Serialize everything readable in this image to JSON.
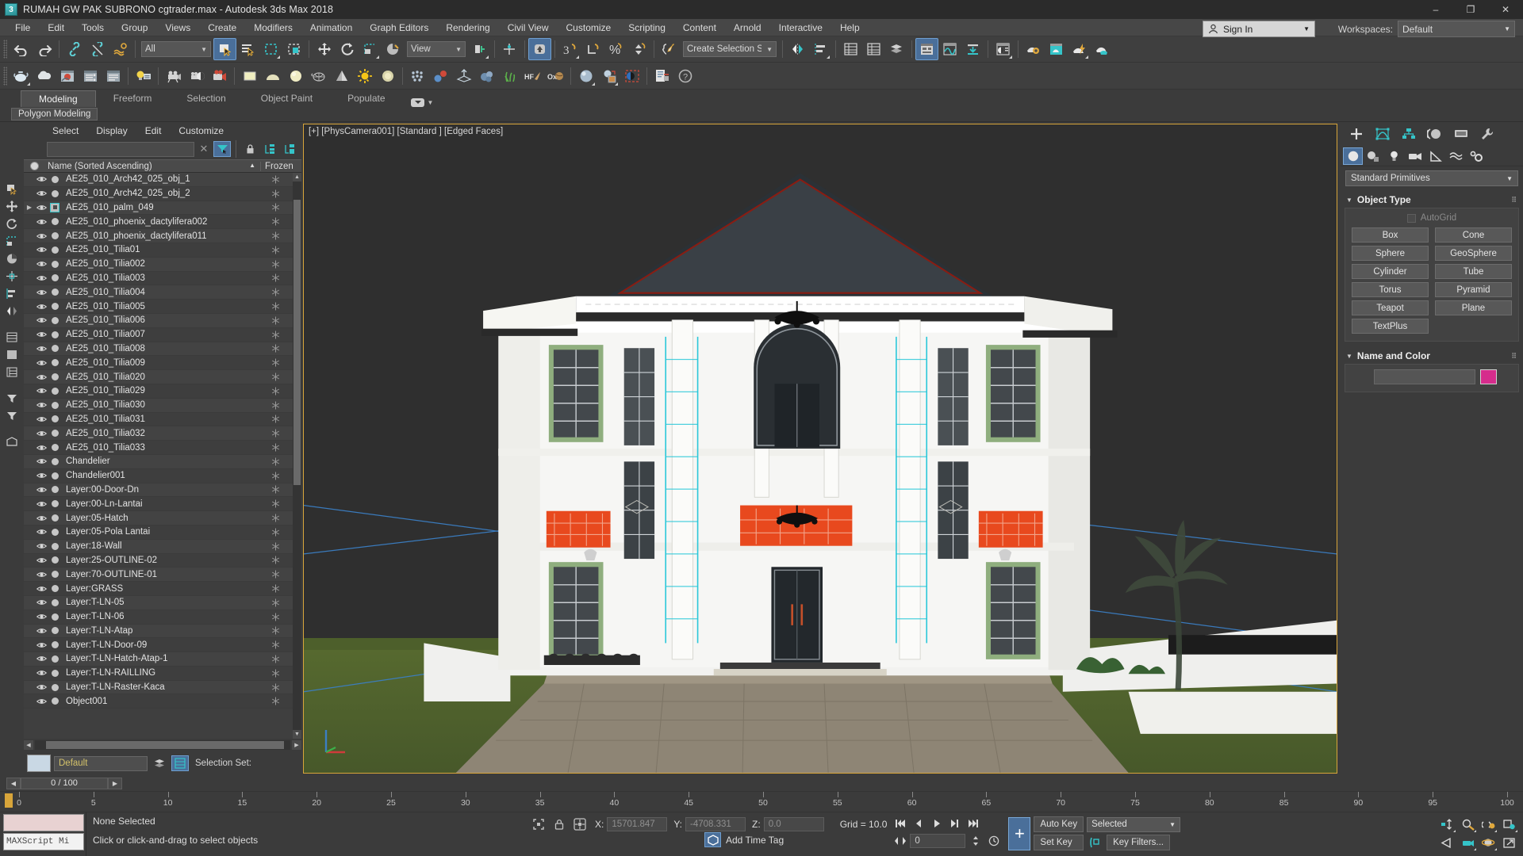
{
  "titlebar": {
    "title": "RUMAH GW PAK SUBRONO cgtrader.max - Autodesk 3ds Max 2018",
    "icon": "max-logo-icon",
    "minimize": "–",
    "maximize": "❐",
    "close": "✕"
  },
  "menubar": {
    "items": [
      "File",
      "Edit",
      "Tools",
      "Group",
      "Views",
      "Create",
      "Modifiers",
      "Animation",
      "Graph Editors",
      "Rendering",
      "Civil View",
      "Customize",
      "Scripting",
      "Content",
      "Arnold",
      "Interactive",
      "Help"
    ]
  },
  "account": {
    "sign_in": "Sign In",
    "workspaces_label": "Workspaces:",
    "workspace_value": "Default"
  },
  "toolbar1": {
    "selection_filter": "All",
    "reference_coord": "View",
    "selection_set": "Create Selection Se"
  },
  "ribbon": {
    "tabs": [
      "Modeling",
      "Freeform",
      "Selection",
      "Object Paint",
      "Populate"
    ],
    "active_tab": "Modeling",
    "subtab": "Polygon Modeling"
  },
  "explorer": {
    "menu": [
      "Select",
      "Display",
      "Edit",
      "Customize"
    ],
    "search_value": "",
    "columns": {
      "name": "Name (Sorted Ascending)",
      "sort_arrow": "▲",
      "frozen": "Frozen"
    },
    "rows": [
      {
        "name": "AE25_010_Arch42_025_obj_1",
        "expandable": false,
        "selected": false
      },
      {
        "name": "AE25_010_Arch42_025_obj_2",
        "expandable": false,
        "selected": false
      },
      {
        "name": "AE25_010_palm_049",
        "expandable": true,
        "selected": true
      },
      {
        "name": "AE25_010_phoenix_dactylifera002",
        "expandable": false,
        "selected": false
      },
      {
        "name": "AE25_010_phoenix_dactylifera011",
        "expandable": false,
        "selected": false
      },
      {
        "name": "AE25_010_Tilia01",
        "expandable": false,
        "selected": false
      },
      {
        "name": "AE25_010_Tilia002",
        "expandable": false,
        "selected": false
      },
      {
        "name": "AE25_010_Tilia003",
        "expandable": false,
        "selected": false
      },
      {
        "name": "AE25_010_Tilia004",
        "expandable": false,
        "selected": false
      },
      {
        "name": "AE25_010_Tilia005",
        "expandable": false,
        "selected": false
      },
      {
        "name": "AE25_010_Tilia006",
        "expandable": false,
        "selected": false
      },
      {
        "name": "AE25_010_Tilia007",
        "expandable": false,
        "selected": false
      },
      {
        "name": "AE25_010_Tilia008",
        "expandable": false,
        "selected": false
      },
      {
        "name": "AE25_010_Tilia009",
        "expandable": false,
        "selected": false
      },
      {
        "name": "AE25_010_Tilia020",
        "expandable": false,
        "selected": false
      },
      {
        "name": "AE25_010_Tilia029",
        "expandable": false,
        "selected": false
      },
      {
        "name": "AE25_010_Tilia030",
        "expandable": false,
        "selected": false
      },
      {
        "name": "AE25_010_Tilia031",
        "expandable": false,
        "selected": false
      },
      {
        "name": "AE25_010_Tilia032",
        "expandable": false,
        "selected": false
      },
      {
        "name": "AE25_010_Tilia033",
        "expandable": false,
        "selected": false
      },
      {
        "name": "Chandelier",
        "expandable": false,
        "selected": false
      },
      {
        "name": "Chandelier001",
        "expandable": false,
        "selected": false
      },
      {
        "name": "Layer:00-Door-Dn",
        "expandable": false,
        "selected": false
      },
      {
        "name": "Layer:00-Ln-Lantai",
        "expandable": false,
        "selected": false
      },
      {
        "name": "Layer:05-Hatch",
        "expandable": false,
        "selected": false
      },
      {
        "name": "Layer:05-Pola Lantai",
        "expandable": false,
        "selected": false
      },
      {
        "name": "Layer:18-Wall",
        "expandable": false,
        "selected": false
      },
      {
        "name": "Layer:25-OUTLINE-02",
        "expandable": false,
        "selected": false
      },
      {
        "name": "Layer:70-OUTLINE-01",
        "expandable": false,
        "selected": false
      },
      {
        "name": "Layer:GRASS",
        "expandable": false,
        "selected": false
      },
      {
        "name": "Layer:T-LN-05",
        "expandable": false,
        "selected": false
      },
      {
        "name": "Layer:T-LN-06",
        "expandable": false,
        "selected": false
      },
      {
        "name": "Layer:T-LN-Atap",
        "expandable": false,
        "selected": false
      },
      {
        "name": "Layer:T-LN-Door-09",
        "expandable": false,
        "selected": false
      },
      {
        "name": "Layer:T-LN-Hatch-Atap-1",
        "expandable": false,
        "selected": false
      },
      {
        "name": "Layer:T-LN-RAILLING",
        "expandable": false,
        "selected": false
      },
      {
        "name": "Layer:T-LN-Raster-Kaca",
        "expandable": false,
        "selected": false
      },
      {
        "name": "Object001",
        "expandable": false,
        "selected": false
      }
    ],
    "selection_set_label": "Selection Set:",
    "layer_value": "Default"
  },
  "viewport": {
    "label": "[+] [PhysCamera001] [Standard ] [Edged Faces]",
    "border_color": "#d8a53a",
    "background": "#2f2f2f",
    "ground_color": "#56692f"
  },
  "command_panel": {
    "tabs": [
      "create-tab",
      "modify-tab",
      "hierarchy-tab",
      "motion-tab",
      "display-tab",
      "utilities-tab"
    ],
    "active_tab": "create-tab",
    "subtabs": [
      "geometry-icon",
      "shapes-icon",
      "lights-icon",
      "cameras-icon",
      "helpers-icon",
      "space-warps-icon",
      "systems-icon"
    ],
    "active_subtab": "geometry-icon",
    "category": "Standard Primitives",
    "object_type": {
      "title": "Object Type",
      "autogrid_label": "AutoGrid",
      "autogrid_checked": false,
      "buttons": [
        "Box",
        "Cone",
        "Sphere",
        "GeoSphere",
        "Cylinder",
        "Tube",
        "Torus",
        "Pyramid",
        "Teapot",
        "Plane",
        "TextPlus"
      ]
    },
    "name_and_color": {
      "title": "Name and Color",
      "name_value": "",
      "color": "#d62c8c"
    }
  },
  "timeline": {
    "frame_field": "0 / 100",
    "prev": "◀",
    "next": "▶",
    "ticks": [
      0,
      5,
      10,
      15,
      20,
      25,
      30,
      35,
      40,
      45,
      50,
      55,
      60,
      65,
      70,
      75,
      80,
      85,
      90,
      95,
      100
    ]
  },
  "statusbar": {
    "maxscript_placeholder": "MAXScript Mi",
    "selection_status": "None Selected",
    "prompt": "Click or click-and-drag to select objects",
    "coords": {
      "x_label": "X:",
      "x_value": "15701.847",
      "y_label": "Y:",
      "y_value": "-4708.331",
      "z_label": "Z:",
      "z_value": "0.0",
      "grid": "Grid = 10.0"
    },
    "add_time_tag": "Add Time Tag",
    "animation": {
      "auto_key": "Auto Key",
      "set_key": "Set Key",
      "key_mode": "Selected",
      "key_filters": "Key Filters...",
      "current_frame": "0"
    }
  }
}
